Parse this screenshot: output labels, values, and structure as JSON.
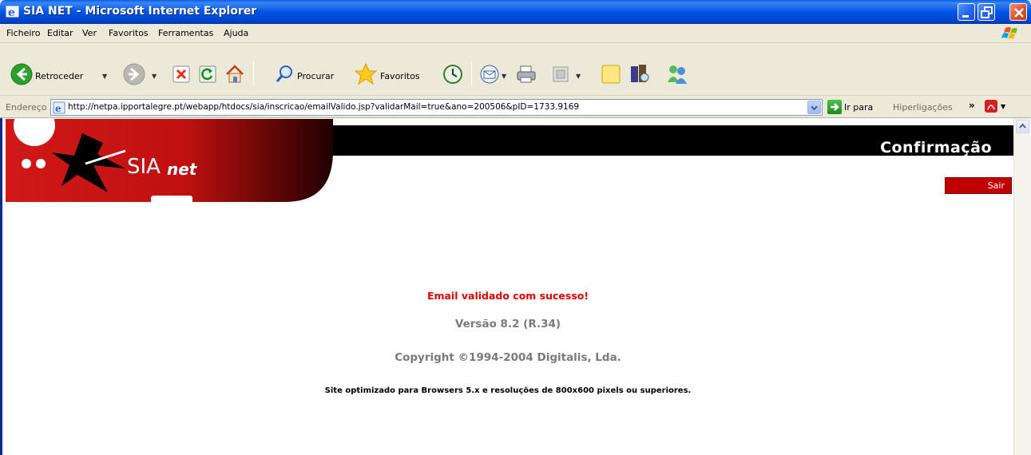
{
  "window": {
    "title": "SIA NET - Microsoft Internet Explorer",
    "minimize_icon": "minimize-icon",
    "maximize_icon": "restore-icon",
    "close_icon": "close-icon"
  },
  "menu": {
    "items": [
      "Ficheiro",
      "Editar",
      "Ver",
      "Favoritos",
      "Ferramentas",
      "Ajuda"
    ]
  },
  "toolbar": {
    "back_label": "Retroceder",
    "search_label": "Procurar",
    "favorites_label": "Favoritos"
  },
  "address": {
    "label": "Endereço",
    "url": "http://netpa.ipportalegre.pt/webapp/htdocs/sia/inscricao/emailValido.jsp?validarMail=true&ano=200506&pID=1733.9169",
    "go_label": "Ir para",
    "links_label": "Hiperligações"
  },
  "page": {
    "logo_text_main": "SIA",
    "logo_text_suffix": "net",
    "heading": "Confirmação",
    "logout_label": "Sair",
    "success_message": "Email validado com sucesso!",
    "version": "Versão 8.2 (R.34)",
    "copyright": "Copyright ©1994-2004 Digitalis, Lda.",
    "note": "Site optimizado para Browsers 5.x e resoluções de 800x600 pixels ou superiores."
  },
  "colors": {
    "brand_red": "#c00000",
    "success_red": "#e00000",
    "xp_blue": "#0055e5"
  }
}
